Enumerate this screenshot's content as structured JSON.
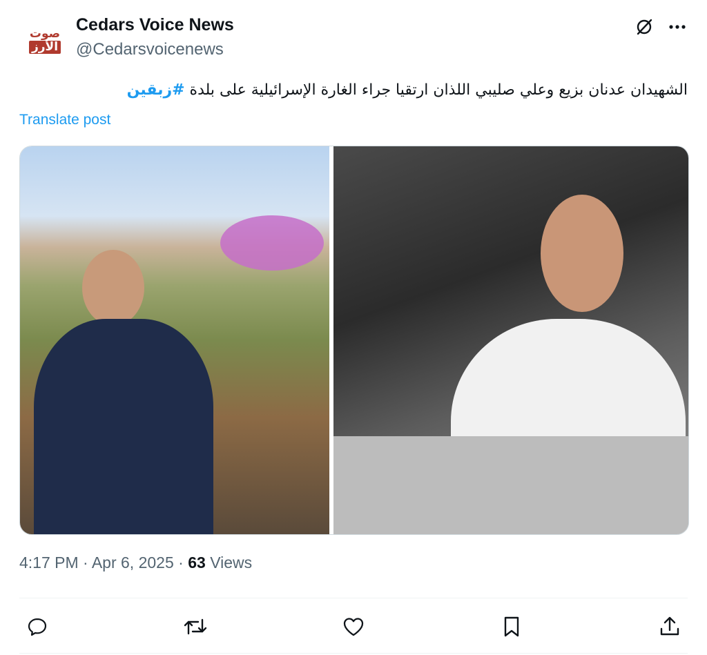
{
  "post": {
    "author_name": "Cedars Voice News",
    "author_handle": "@Cedarsvoicenews",
    "avatar_text_line1": "صوت",
    "avatar_text_line2": "الأرز",
    "text_plain": "الشهيدان عدنان بزيع وعلي صليبي اللذان ارتقيا جراء الغارة الإسرائيلية على بلدة ",
    "hashtag": "#زبقين",
    "translate_label": "Translate post",
    "time": "4:17 PM",
    "date": "Apr 6, 2025",
    "views_count": "63",
    "views_label": "Views"
  },
  "icons": {
    "header": [
      "grok-icon",
      "more-icon"
    ],
    "actions": [
      "reply-icon",
      "repost-icon",
      "like-icon",
      "bookmark-icon",
      "share-icon"
    ]
  },
  "colors": {
    "accent": "#1d9bf0",
    "text": "#0f1419",
    "muted": "#536471",
    "avatar_brand": "#b03a2e"
  }
}
